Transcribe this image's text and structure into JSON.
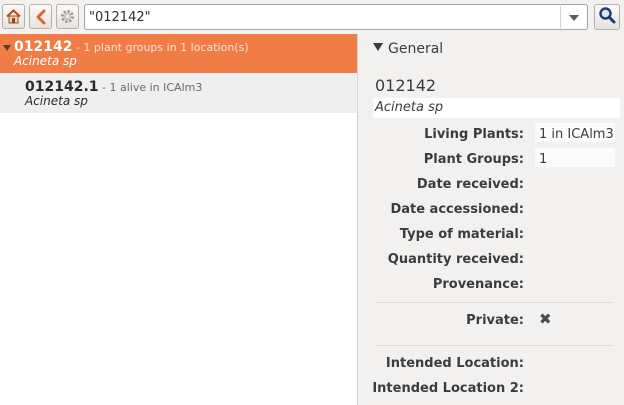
{
  "toolbar": {
    "home_icon": "home-icon",
    "back_icon": "chevron-left-icon",
    "settings_icon": "gear-icon",
    "search_value": "\"012142\"",
    "dropdown_icon": "chevron-down-icon",
    "go_icon": "search-icon"
  },
  "results": [
    {
      "accession": "012142",
      "meta": " - 1 plant groups in 1 location(s)",
      "taxon": "Acineta sp",
      "selected": true
    },
    {
      "accession": "012142.1",
      "meta": " - 1 alive in ICAlm3",
      "taxon": "Acineta sp",
      "selected": false
    }
  ],
  "infobox": {
    "section_title": "General",
    "accession": "012142",
    "taxon": "Acineta sp",
    "fields": {
      "living_plants_label": "Living Plants:",
      "living_plants_value": "1 in ICAlm3",
      "plant_groups_label": "Plant Groups:",
      "plant_groups_value": "1",
      "date_received_label": "Date received:",
      "date_accessioned_label": "Date accessioned:",
      "type_of_material_label": "Type of material:",
      "quantity_received_label": "Quantity received:",
      "provenance_label": "Provenance:",
      "private_label": "Private:",
      "private_value": "✖",
      "intended_location_label": "Intended Location:",
      "intended_location2_label": "Intended Location 2:"
    }
  },
  "colors": {
    "selection": "#ef7d45",
    "home_accent": "#d94a1f",
    "search_button_accent": "#1e3f73"
  }
}
